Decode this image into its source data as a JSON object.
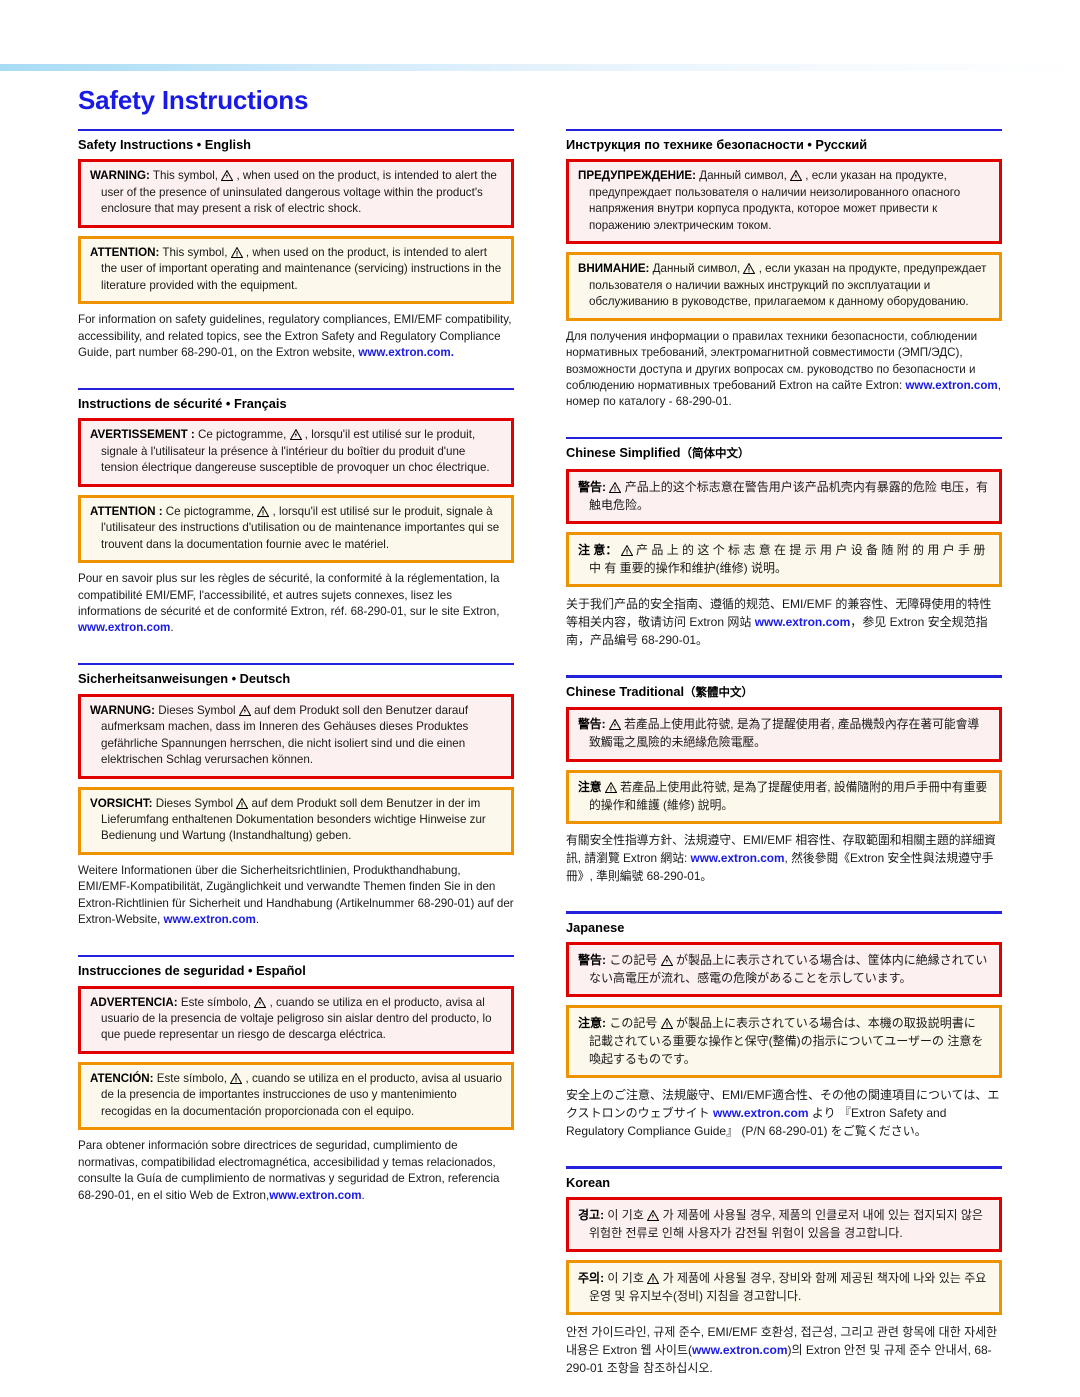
{
  "document": {
    "title": "Safety Instructions",
    "accent_blue": "#1a1ae6",
    "warning_border": "#e00000",
    "warning_fill": "#fdf0f0",
    "attention_border": "#ef9200",
    "attention_fill": "#fdf8ec",
    "url": "www.extron.com",
    "part_number": "68-290-01"
  },
  "icons": {
    "warning_triangle": "warning-lightning-triangle-icon",
    "attention_triangle": "warning-exclamation-triangle-icon"
  },
  "left_column": {
    "english": {
      "heading": "Safety Instructions • English",
      "warning_lead": "WARNING:",
      "warning_text_a": "This symbol,",
      "warning_text_b": ", when used on the product, is intended to alert the user of the presence of uninsulated dangerous voltage within the product's enclosure that may present a risk of electric shock.",
      "attention_lead": "ATTENTION:",
      "attention_text_a": "This symbol,",
      "attention_text_b": ", when used on the product, is intended to alert the user of important operating and maintenance (servicing) instructions in the literature provided with the equipment.",
      "body_a": "For information on safety guidelines, regulatory compliances, EMI/EMF compatibility, accessibility, and related topics, see the Extron Safety and Regulatory Compliance Guide, part number 68-290-01, on the Extron website, ",
      "body_link": "www.extron.com.",
      "body_b": ""
    },
    "french": {
      "heading": "Instructions de sécurité • Français",
      "warning_lead": "AVERTISSEMENT :",
      "warning_text_a": "Ce pictogramme,",
      "warning_text_b": ", lorsqu'il est utilisé sur le produit, signale à l'utilisateur la présence à l'intérieur du boîtier du produit d'une tension électrique dangereuse susceptible de provoquer un choc électrique.",
      "attention_lead": "ATTENTION :",
      "attention_text_a": "Ce pictogramme,",
      "attention_text_b": ", lorsqu'il est utilisé sur le produit, signale à l'utilisateur des instructions d'utilisation ou de maintenance importantes qui se trouvent dans la documentation fournie avec le matériel.",
      "body_a": "Pour en savoir plus sur les règles de sécurité, la conformité à la réglementation, la compatibilité EMI/EMF, l'accessibilité, et autres sujets connexes, lisez les informations de sécurité et de conformité Extron, réf. 68-290-01, sur le site Extron, ",
      "body_link": "www.extron.com",
      "body_b": "."
    },
    "german": {
      "heading": "Sicherheitsanweisungen • Deutsch",
      "warning_lead": "WARNUNG:",
      "warning_text_a": "Dieses Symbol",
      "warning_text_b": "auf dem Produkt soll den Benutzer darauf aufmerksam machen, dass im Inneren des Gehäuses dieses Produktes gefährliche Spannungen herrschen, die nicht isoliert sind und die einen elektrischen Schlag verursachen können.",
      "attention_lead": "VORSICHT:",
      "attention_text_a": "Dieses Symbol",
      "attention_text_b": "auf dem Produkt soll dem Benutzer in der im Lieferumfang enthaltenen Dokumentation besonders wichtige Hinweise zur Bedienung und Wartung (Instandhaltung) geben.",
      "body_a": "Weitere Informationen über die Sicherheitsrichtlinien, Produkthandhabung, EMI/EMF-Kompatibilität, Zugänglichkeit und verwandte Themen finden Sie in den Extron-Richtlinien für Sicherheit und Handhabung  (Artikelnummer 68-290-01) auf der Extron-Website, ",
      "body_link": "www.extron.com",
      "body_b": "."
    },
    "spanish": {
      "heading": "Instrucciones de seguridad • Español",
      "warning_lead": "ADVERTENCIA:",
      "warning_text_a": "Este símbolo,",
      "warning_text_b": ", cuando se utiliza en el producto, avisa al usuario de la presencia de voltaje peligroso sin aislar dentro del producto, lo que puede representar un riesgo de descarga eléctrica.",
      "attention_lead": "ATENCIÓN:",
      "attention_text_a": "Este símbolo,",
      "attention_text_b": ", cuando se utiliza en el producto, avisa al usuario de la presencia de importantes instrucciones de uso y mantenimiento recogidas en la documentación proporcionada con el equipo.",
      "body_a": "Para obtener información sobre directrices de seguridad, cumplimiento de normativas,  compatibilidad electromagnética, accesibilidad y temas relacionados, consulte la  Guía de cumplimiento de normativas y seguridad de Extron, referencia 68-290-01, en el sitio Web de Extron,",
      "body_link": "www.extron.com",
      "body_b": "."
    }
  },
  "right_column": {
    "russian": {
      "heading": "Инструкция по технике безопасности • Русский",
      "warning_lead": "ПРЕДУПРЕЖДЕНИЕ:",
      "warning_text_a": "Данный символ,",
      "warning_text_b": ", если указан на продукте, предупреждает пользователя о наличии неизолированного опасного напряжения внутри корпуса продукта, которое может привести к поражению электрическим током.",
      "attention_lead": "ВНИМАНИЕ:",
      "attention_text_a": "Данный символ,",
      "attention_text_b": ", если указан на продукте, предупреждает пользователя о наличии важных инструкций по эксплуатации и обслуживанию в руководстве, прилагаемом к данному оборудованию.",
      "body_a": "Для получения информации о правилах техники безопасности, соблюдении нормативных требований, электромагнитной совместимости (ЭМП/ЭДС), возможности доступа и других вопросах см. руководство по безопасности и соблюдению нормативных требований Extron на сайте Extron: ",
      "body_link": "www.extron.com",
      "body_b": ", номер по каталогу - 68-290-01."
    },
    "chinese_simplified": {
      "heading_en": "Chinese Simplified",
      "heading_native": "（简体中文）",
      "warning_lead": "警告:",
      "warning_text_a": "",
      "warning_text_b": "产品上的这个标志意在警告用户该产品机壳内有暴露的危险 电压，有触电危险。",
      "attention_lead": "注 意：",
      "attention_text_a": "",
      "attention_text_b": "产 品 上 的 这 个 标 志 意 在 提 示 用 户 设 备 随 附 的 用 户 手 册 中 有 重要的操作和维护(维修) 说明。",
      "body_a": "关于我们产品的安全指南、遵循的规范、EMI/EMF 的兼容性、无障碍使用的特性等相关内容，敬请访问 Extron 网站 ",
      "body_link": "www.extron.com",
      "body_b": "，参见 Extron 安全规范指南，产品编号 68-290-01。"
    },
    "chinese_traditional": {
      "heading_en": "Chinese Traditional",
      "heading_native": "（繁體中文）",
      "warning_lead": "警告:",
      "warning_text_a": "",
      "warning_text_b": "若產品上使用此符號, 是為了提醒使用者, 產品機殼內存在著可能會導致觸電之風險的未絕緣危險電壓。",
      "attention_lead": "注意",
      "attention_text_a": "",
      "attention_text_b": "若產品上使用此符號, 是為了提醒使用者, 設備隨附的用戶手冊中有重要的操作和維護 (維修) 說明。",
      "body_a": "有關安全性指導方針、法規遵守、EMI/EMF  相容性、存取範圍和相關主題的詳細資訊, 請瀏覽 Extron  網站: ",
      "body_link": "www.extron.com",
      "body_b": ", 然後參閱《Extron  安全性與法規遵守手冊》, 準則編號 68-290-01。"
    },
    "japanese": {
      "heading": "Japanese",
      "warning_lead": "警告:",
      "warning_text_a": "この記号",
      "warning_text_b": "が製品上に表示されている場合は、筐体内に絶縁されていない高電圧が流れ、感電の危険があることを示しています。",
      "attention_lead": "注意:",
      "attention_text_a": "この記号",
      "attention_text_b": "が製品上に表示されている場合は、本機の取扱説明書に 記載されている重要な操作と保守(整備)の指示についてユーザーの 注意を喚起するものです。",
      "body_a": "安全上のご注意、法規厳守、EMI/EMF適合性、その他の関連項目については、エクストロンのウェブサイト ",
      "body_link": "www.extron.com",
      "body_b": " より 『Extron Safety and Regulatory Compliance Guide』 (P/N 68-290-01) をご覧ください。"
    },
    "korean": {
      "heading": "Korean",
      "warning_lead": "경고:",
      "warning_text_a": "이 기호",
      "warning_text_b": "가 제품에 사용될 경우, 제품의 인클로저 내에 있는 접지되지 않은 위험한 전류로 인해 사용자가 감전될 위험이 있음을 경고합니다.",
      "attention_lead": "주의:",
      "attention_text_a": "이 기호",
      "attention_text_b": "가 제품에 사용될 경우, 장비와 함께 제공된 책자에 나와 있는 주요 운영 및 유지보수(정비) 지침을 경고합니다.",
      "body_a": "안전 가이드라인, 규제 준수, EMI/EMF 호환성, 접근성, 그리고 관련 항목에 대한 자세한 내용은 Extron 웹 사이트(",
      "body_link": "www.extron.com",
      "body_b": ")의 Extron 안전 및 규제 준수 안내서, 68-290-01 조항을 참조하십시오."
    }
  }
}
